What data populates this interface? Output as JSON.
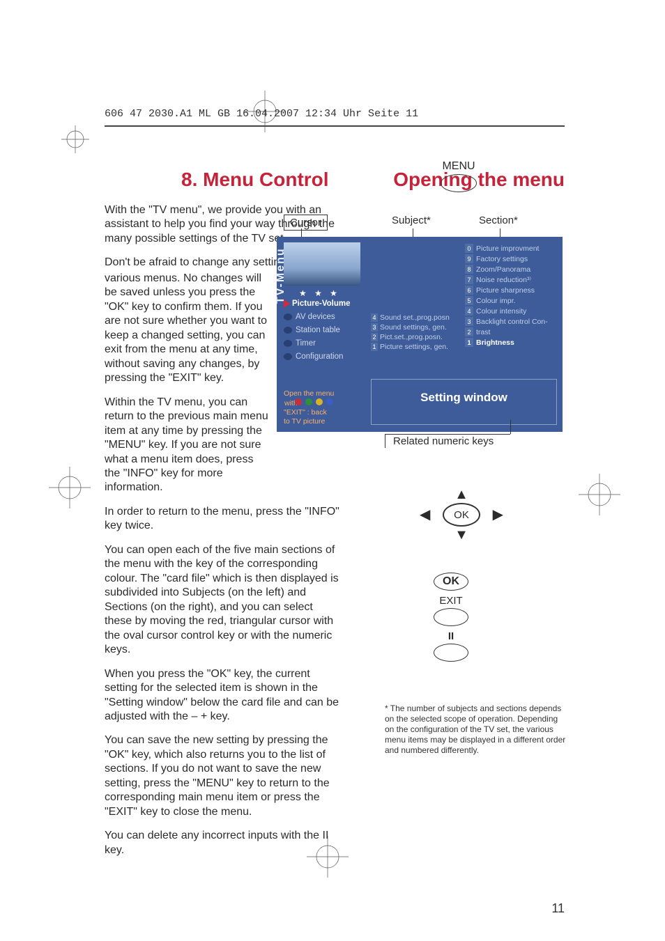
{
  "header_line": "606 47 2030.A1  ML GB  16.04.2007  12:34 Uhr  Seite 11",
  "titles": {
    "left": "8. Menu Control",
    "right": "Opening the menu"
  },
  "paragraphs": {
    "p1": "With the \"TV menu\", we provide you with an assistant to help you find your way through the many possible settings of the TV set.",
    "p2a": "Don't be afraid to change any settings in the",
    "p2b": "various menus. No changes will be saved unless you press the \"OK\" key to confirm them. If you are not sure whether you want to keep a changed setting, you can exit from the menu at any time, without saving any changes, by pressing the \"EXIT\" key.",
    "p3": "Within the TV menu, you can return to the previous main menu item at any time by pressing the \"MENU\" key. If you are not sure what a menu item does, press the \"INFO\" key for more information.",
    "p4": "In order to return to the menu, press the \"INFO\" key twice.",
    "p5": "You can open each of the five main sections of the menu with the key of the corresponding colour. The \"card file\" which is then displayed is subdivided into Subjects (on the left) and Sections (on the right), and you can select these by moving the red, triangular cursor with the oval cursor control key or with the numeric keys.",
    "p6": "When you press the \"OK\" key, the current setting for the selected item is shown in the \"Setting window\" below the card file and can be adjusted with the – + key.",
    "p7": "You can save the new setting by pressing the \"OK\" key, which also returns you to the list of sections. If you do not want to save the new setting, press the \"MENU\" key to return to the corresponding main menu item or press the \"EXIT\" key to close the menu.",
    "p8": "You can delete any incorrect inputs with the II key."
  },
  "diagram": {
    "menu_btn": "MENU",
    "cursor_label": "Cursor",
    "subject_label": "Subject*",
    "section_label": "Section*",
    "tv_menu_label": "TV-Menu",
    "stars": "★ ★ ★",
    "main_items": {
      "selected": "Picture-Volume",
      "others": [
        "AV devices",
        "Station table",
        "Timer",
        "Configuration"
      ]
    },
    "open_menu_note": {
      "line1": "Open the menu",
      "line2_prefix": "with",
      "line3": "\"EXIT\" : back",
      "line4": "to TV picture"
    },
    "subjects": [
      {
        "n": "4",
        "t": "Sound set.,prog.posn"
      },
      {
        "n": "3",
        "t": "Sound settings, gen."
      },
      {
        "n": "2",
        "t": "Pict.set.,prog.posn."
      },
      {
        "n": "1",
        "t": "Picture settings, gen."
      }
    ],
    "sections": [
      {
        "n": "0",
        "t": "Picture improvment"
      },
      {
        "n": "9",
        "t": "Factory settings"
      },
      {
        "n": "8",
        "t": "Zoom/Panorama"
      },
      {
        "n": "7",
        "t": "Noise reduction³⁾"
      },
      {
        "n": "6",
        "t": "Picture sharpness"
      },
      {
        "n": "5",
        "t": "Colour impr."
      },
      {
        "n": "4",
        "t": "Colour intensity"
      },
      {
        "n": "3",
        "t": "Backlight control Con-"
      },
      {
        "n": "2",
        "t": "trast"
      },
      {
        "n": "1",
        "t": "Brightness",
        "hl": true
      }
    ],
    "setting_window": "Setting window",
    "related_numeric_keys": "Related numeric keys"
  },
  "controls": {
    "ok": "OK",
    "exit": "EXIT",
    "pause": "II"
  },
  "footnote": "* The number of subjects and sections depends on the selected scope of operation. Depending on the configuration of the TV set, the various menu items may be displayed in a different order and numbered differently.",
  "page_number": "11"
}
